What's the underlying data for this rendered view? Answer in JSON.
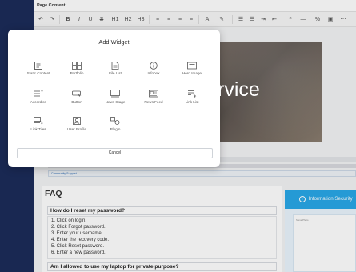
{
  "editor": {
    "title": "Page Content",
    "toolbar": [
      {
        "icon": "undo-icon",
        "glyph": "↶"
      },
      {
        "icon": "redo-icon",
        "glyph": "↷"
      },
      {
        "icon": "bold-icon",
        "glyph": "B"
      },
      {
        "icon": "italic-icon",
        "glyph": "I"
      },
      {
        "icon": "underline-icon",
        "glyph": "U"
      },
      {
        "icon": "strikethrough-icon",
        "glyph": "S"
      },
      {
        "icon": "heading1-icon",
        "glyph": "H1"
      },
      {
        "icon": "heading2-icon",
        "glyph": "H2"
      },
      {
        "icon": "heading3-icon",
        "glyph": "H3"
      },
      {
        "icon": "align-left-icon",
        "glyph": "≡"
      },
      {
        "icon": "align-center-icon",
        "glyph": "≡"
      },
      {
        "icon": "align-right-icon",
        "glyph": "≡"
      },
      {
        "icon": "align-justify-icon",
        "glyph": "≡"
      },
      {
        "icon": "text-color-icon",
        "glyph": "A"
      },
      {
        "icon": "highlight-icon",
        "glyph": "✎"
      },
      {
        "icon": "bulleted-list-icon",
        "glyph": "☰"
      },
      {
        "icon": "numbered-list-icon",
        "glyph": "☰"
      },
      {
        "icon": "indent-icon",
        "glyph": "⇥"
      },
      {
        "icon": "outdent-icon",
        "glyph": "⇤"
      },
      {
        "icon": "quote-icon",
        "glyph": "❝"
      },
      {
        "icon": "horizontal-rule-icon",
        "glyph": "—"
      },
      {
        "icon": "link-icon",
        "glyph": "%"
      },
      {
        "icon": "image-icon",
        "glyph": "▣"
      },
      {
        "icon": "more-icon",
        "glyph": "⋯"
      }
    ]
  },
  "hero": {
    "text": "rvice"
  },
  "breadcrumb": {
    "text": "Community Support"
  },
  "faq": {
    "title": "FAQ",
    "q1": "How do I reset my password?",
    "steps": [
      "1. Click on login.",
      "2. Click Forgot password.",
      "3. Enter your username.",
      "4. Enter the recovery code.",
      "5. Click Reset password.",
      "6. Enter a new password."
    ],
    "q2": "Am I allowed to use my laptop for private purpose?"
  },
  "info": {
    "title": "Information Security",
    "inner_label": "Some Photo"
  },
  "dialog": {
    "title": "Add Widget",
    "widgets": [
      {
        "label": "Static Content",
        "icon": "static-content-icon"
      },
      {
        "label": "Portfolio",
        "icon": "portfolio-icon"
      },
      {
        "label": "File List",
        "icon": "file-list-icon"
      },
      {
        "label": "Infobox",
        "icon": "infobox-icon"
      },
      {
        "label": "Hero Image",
        "icon": "hero-image-icon"
      },
      {
        "label": "Accordion",
        "icon": "accordion-icon"
      },
      {
        "label": "Button",
        "icon": "button-icon"
      },
      {
        "label": "News Stage",
        "icon": "news-stage-icon"
      },
      {
        "label": "News Feed",
        "icon": "news-feed-icon"
      },
      {
        "label": "Link List",
        "icon": "link-list-icon"
      },
      {
        "label": "Link Tiles",
        "icon": "link-tiles-icon"
      },
      {
        "label": "User Profile",
        "icon": "user-profile-icon"
      },
      {
        "label": "Plugin",
        "icon": "plugin-icon"
      }
    ],
    "cancel": "Cancel"
  }
}
